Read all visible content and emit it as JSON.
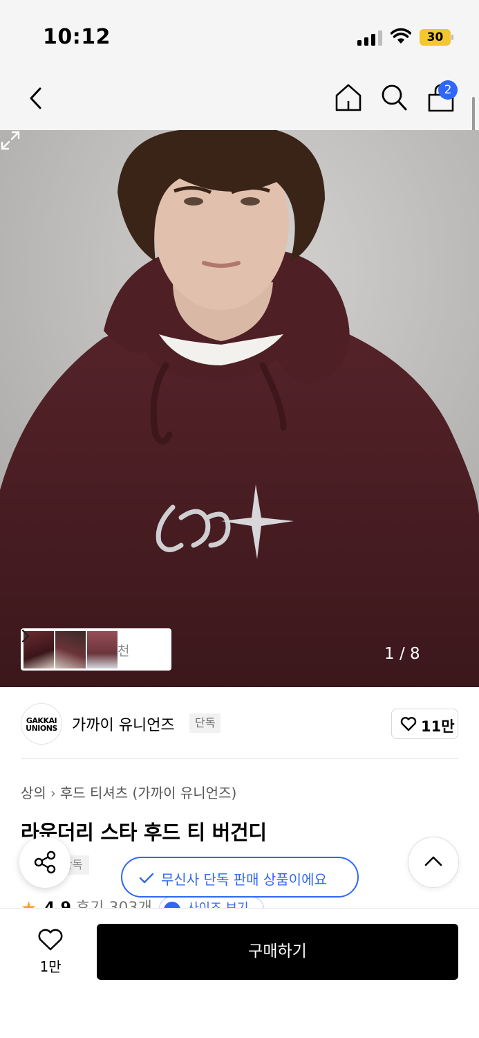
{
  "status_bar": {
    "time": "10:12",
    "battery": "30"
  },
  "nav": {
    "cart_count": "2"
  },
  "gallery": {
    "thumbnail_label": "천",
    "counter": "1 / 8"
  },
  "brand": {
    "logo_line1": "GAKKAI",
    "logo_line2": "UNIONS",
    "name": "가까이 유니언즈",
    "exclusive_tag": "단독",
    "like_count": "11만"
  },
  "product": {
    "breadcrumb": [
      "상의",
      "후드 티셔츠 (가까이 유니언즈)"
    ],
    "title": "라운더리 스타 후드 티 버건디",
    "tag": "단독",
    "rating": "4.9",
    "reviews": "후기 303개",
    "pill": "사이즈 보기"
  },
  "toast": {
    "text": "무신사 단독 판매 상품이에요"
  },
  "bottom_bar": {
    "wish_count": "1만",
    "buy_label": "구매하기"
  },
  "colors": {
    "accent": "#2f67f6",
    "hoodie": "#4a1d21",
    "buy_button": "#000000"
  }
}
